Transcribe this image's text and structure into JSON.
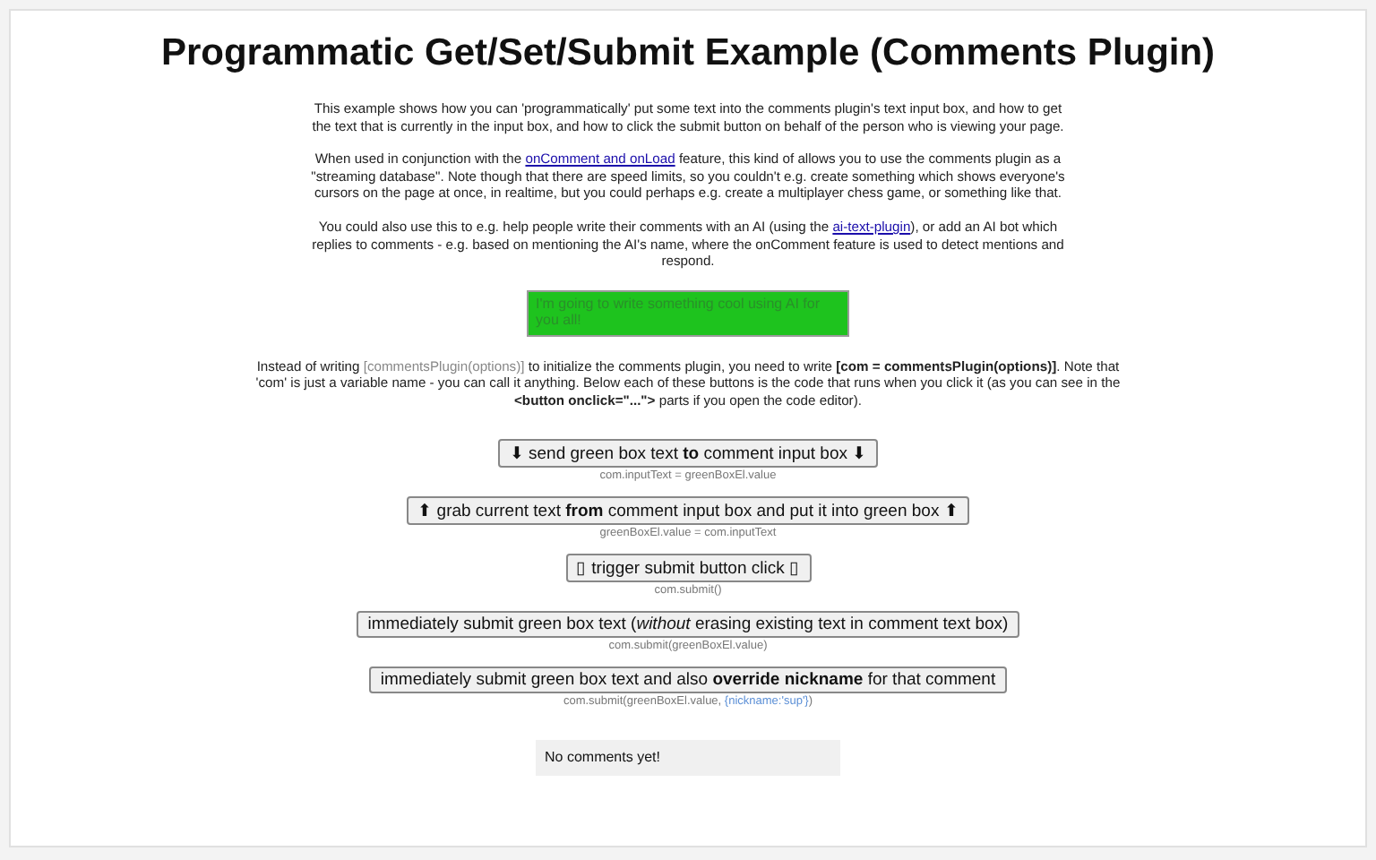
{
  "title": "Programmatic Get/Set/Submit Example (Comments Plugin)",
  "intro": [
    {
      "segments": [
        {
          "kind": "plain",
          "text": "This example shows how you can 'programmatically' put some text into the comments plugin's text input box, and how to get the text that is currently in the input box, and how to click the submit button on behalf of the person who is viewing your page."
        }
      ]
    },
    {
      "segments": [
        {
          "kind": "plain",
          "text": "When used in conjunction with the "
        },
        {
          "kind": "link",
          "text": "onComment and onLoad"
        },
        {
          "kind": "plain",
          "text": " feature, this kind of allows you to use the comments plugin as a \"streaming database\". Note though that there are speed limits, so you couldn't e.g. create something which shows everyone's cursors on the page at once, in realtime, but you could perhaps e.g. create a multiplayer chess game, or something like that."
        }
      ]
    },
    {
      "segments": [
        {
          "kind": "plain",
          "text": "You could also use this to e.g. help people write their comments with an AI (using the "
        },
        {
          "kind": "link",
          "text": "ai-text-plugin"
        },
        {
          "kind": "plain",
          "text": "), or add an AI bot which replies to comments - e.g. based on mentioning the AI's name, where the onComment feature is used to detect mentions and respond."
        }
      ]
    }
  ],
  "green_box": {
    "value": "I'm going to write something cool using AI for you all!"
  },
  "note": {
    "segments": [
      {
        "kind": "plain",
        "text": "Instead of writing "
      },
      {
        "kind": "muted",
        "text": "[commentsPlugin(options)]"
      },
      {
        "kind": "plain",
        "text": " to initialize the comments plugin, you need to write "
      },
      {
        "kind": "bold",
        "text": "[com = commentsPlugin(options)]"
      },
      {
        "kind": "plain",
        "text": ". Note that 'com' is just a variable name - you can call it anything. Below each of these buttons is the code that runs when you click it (as you can see in the "
      },
      {
        "kind": "bold",
        "text": "<button onclick=\"...\">"
      },
      {
        "kind": "plain",
        "text": " parts if you open the code editor)."
      }
    ]
  },
  "actions": [
    {
      "label": "⬇ send green box text **to** comment input box ⬇",
      "code": [
        {
          "kind": "plain",
          "text": "com.inputText = greenBoxEl.value"
        }
      ]
    },
    {
      "label": "⬆ grab current text **from** comment input box and put it into green box ⬆",
      "code": [
        {
          "kind": "plain",
          "text": "greenBoxEl.value = com.inputText"
        }
      ]
    },
    {
      "label": "▯ trigger submit button click ▯",
      "code": [
        {
          "kind": "plain",
          "text": "com.submit()"
        }
      ]
    },
    {
      "label": "immediately submit green box text (*without* erasing existing text in comment text box)",
      "code": [
        {
          "kind": "plain",
          "text": "com.submit(greenBoxEl.value)"
        }
      ]
    },
    {
      "label": "immediately submit green box text and also **override nickname** for that comment",
      "code": [
        {
          "kind": "plain",
          "text": "com.submit(greenBoxEl.value, "
        },
        {
          "kind": "accent",
          "text": "{nickname:'sup'}"
        },
        {
          "kind": "plain",
          "text": ")"
        }
      ]
    }
  ],
  "comments": {
    "empty_message": "No comments yet!"
  }
}
